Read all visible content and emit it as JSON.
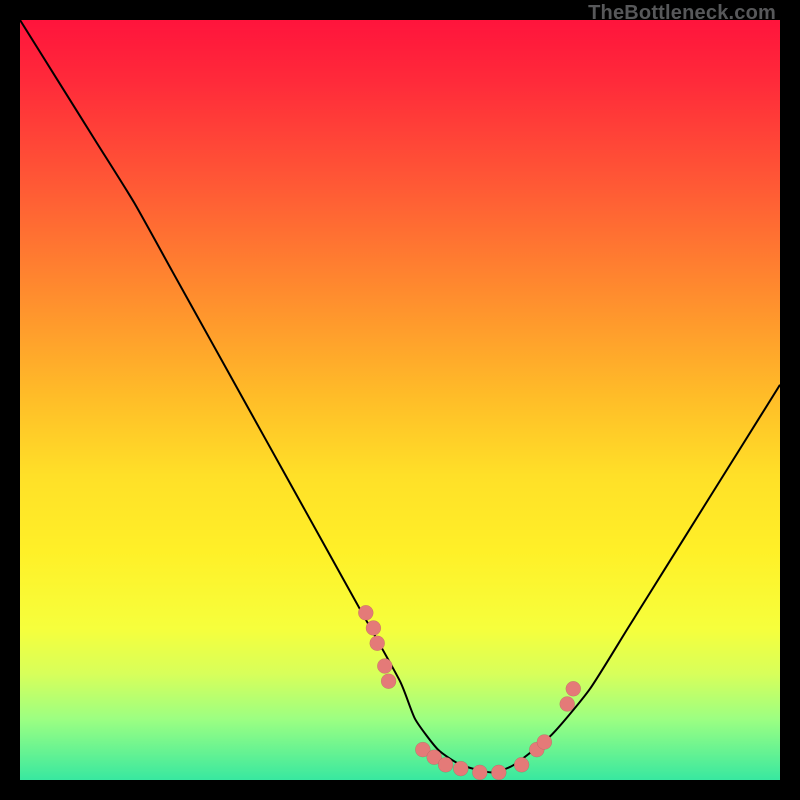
{
  "watermark": "TheBottleneck.com",
  "chart_data": {
    "type": "line",
    "title": "",
    "xlabel": "",
    "ylabel": "",
    "xlim": [
      0,
      100
    ],
    "ylim": [
      0,
      100
    ],
    "grid": false,
    "legend": false,
    "series": [
      {
        "name": "bottleneck-curve",
        "x": [
          0,
          5,
          10,
          15,
          20,
          25,
          30,
          35,
          40,
          45,
          50,
          52,
          55,
          58,
          62,
          65,
          70,
          75,
          80,
          85,
          90,
          95,
          100
        ],
        "y": [
          100,
          92,
          84,
          76,
          67,
          58,
          49,
          40,
          31,
          22,
          13,
          8,
          4,
          2,
          1,
          2,
          6,
          12,
          20,
          28,
          36,
          44,
          52
        ]
      }
    ],
    "points": {
      "name": "sample-points",
      "x": [
        45.5,
        46.5,
        47.0,
        48.0,
        48.5,
        53.0,
        54.5,
        56.0,
        58.0,
        60.5,
        63.0,
        66.0,
        68.0,
        69.0,
        72.0,
        72.8
      ],
      "y": [
        22,
        20,
        18,
        15,
        13,
        4,
        3,
        2,
        1.5,
        1,
        1,
        2,
        4,
        5,
        10,
        12
      ]
    },
    "background_gradient": {
      "top": "#ff143c",
      "mid": "#fff028",
      "bottom": "#38e8a0"
    }
  }
}
